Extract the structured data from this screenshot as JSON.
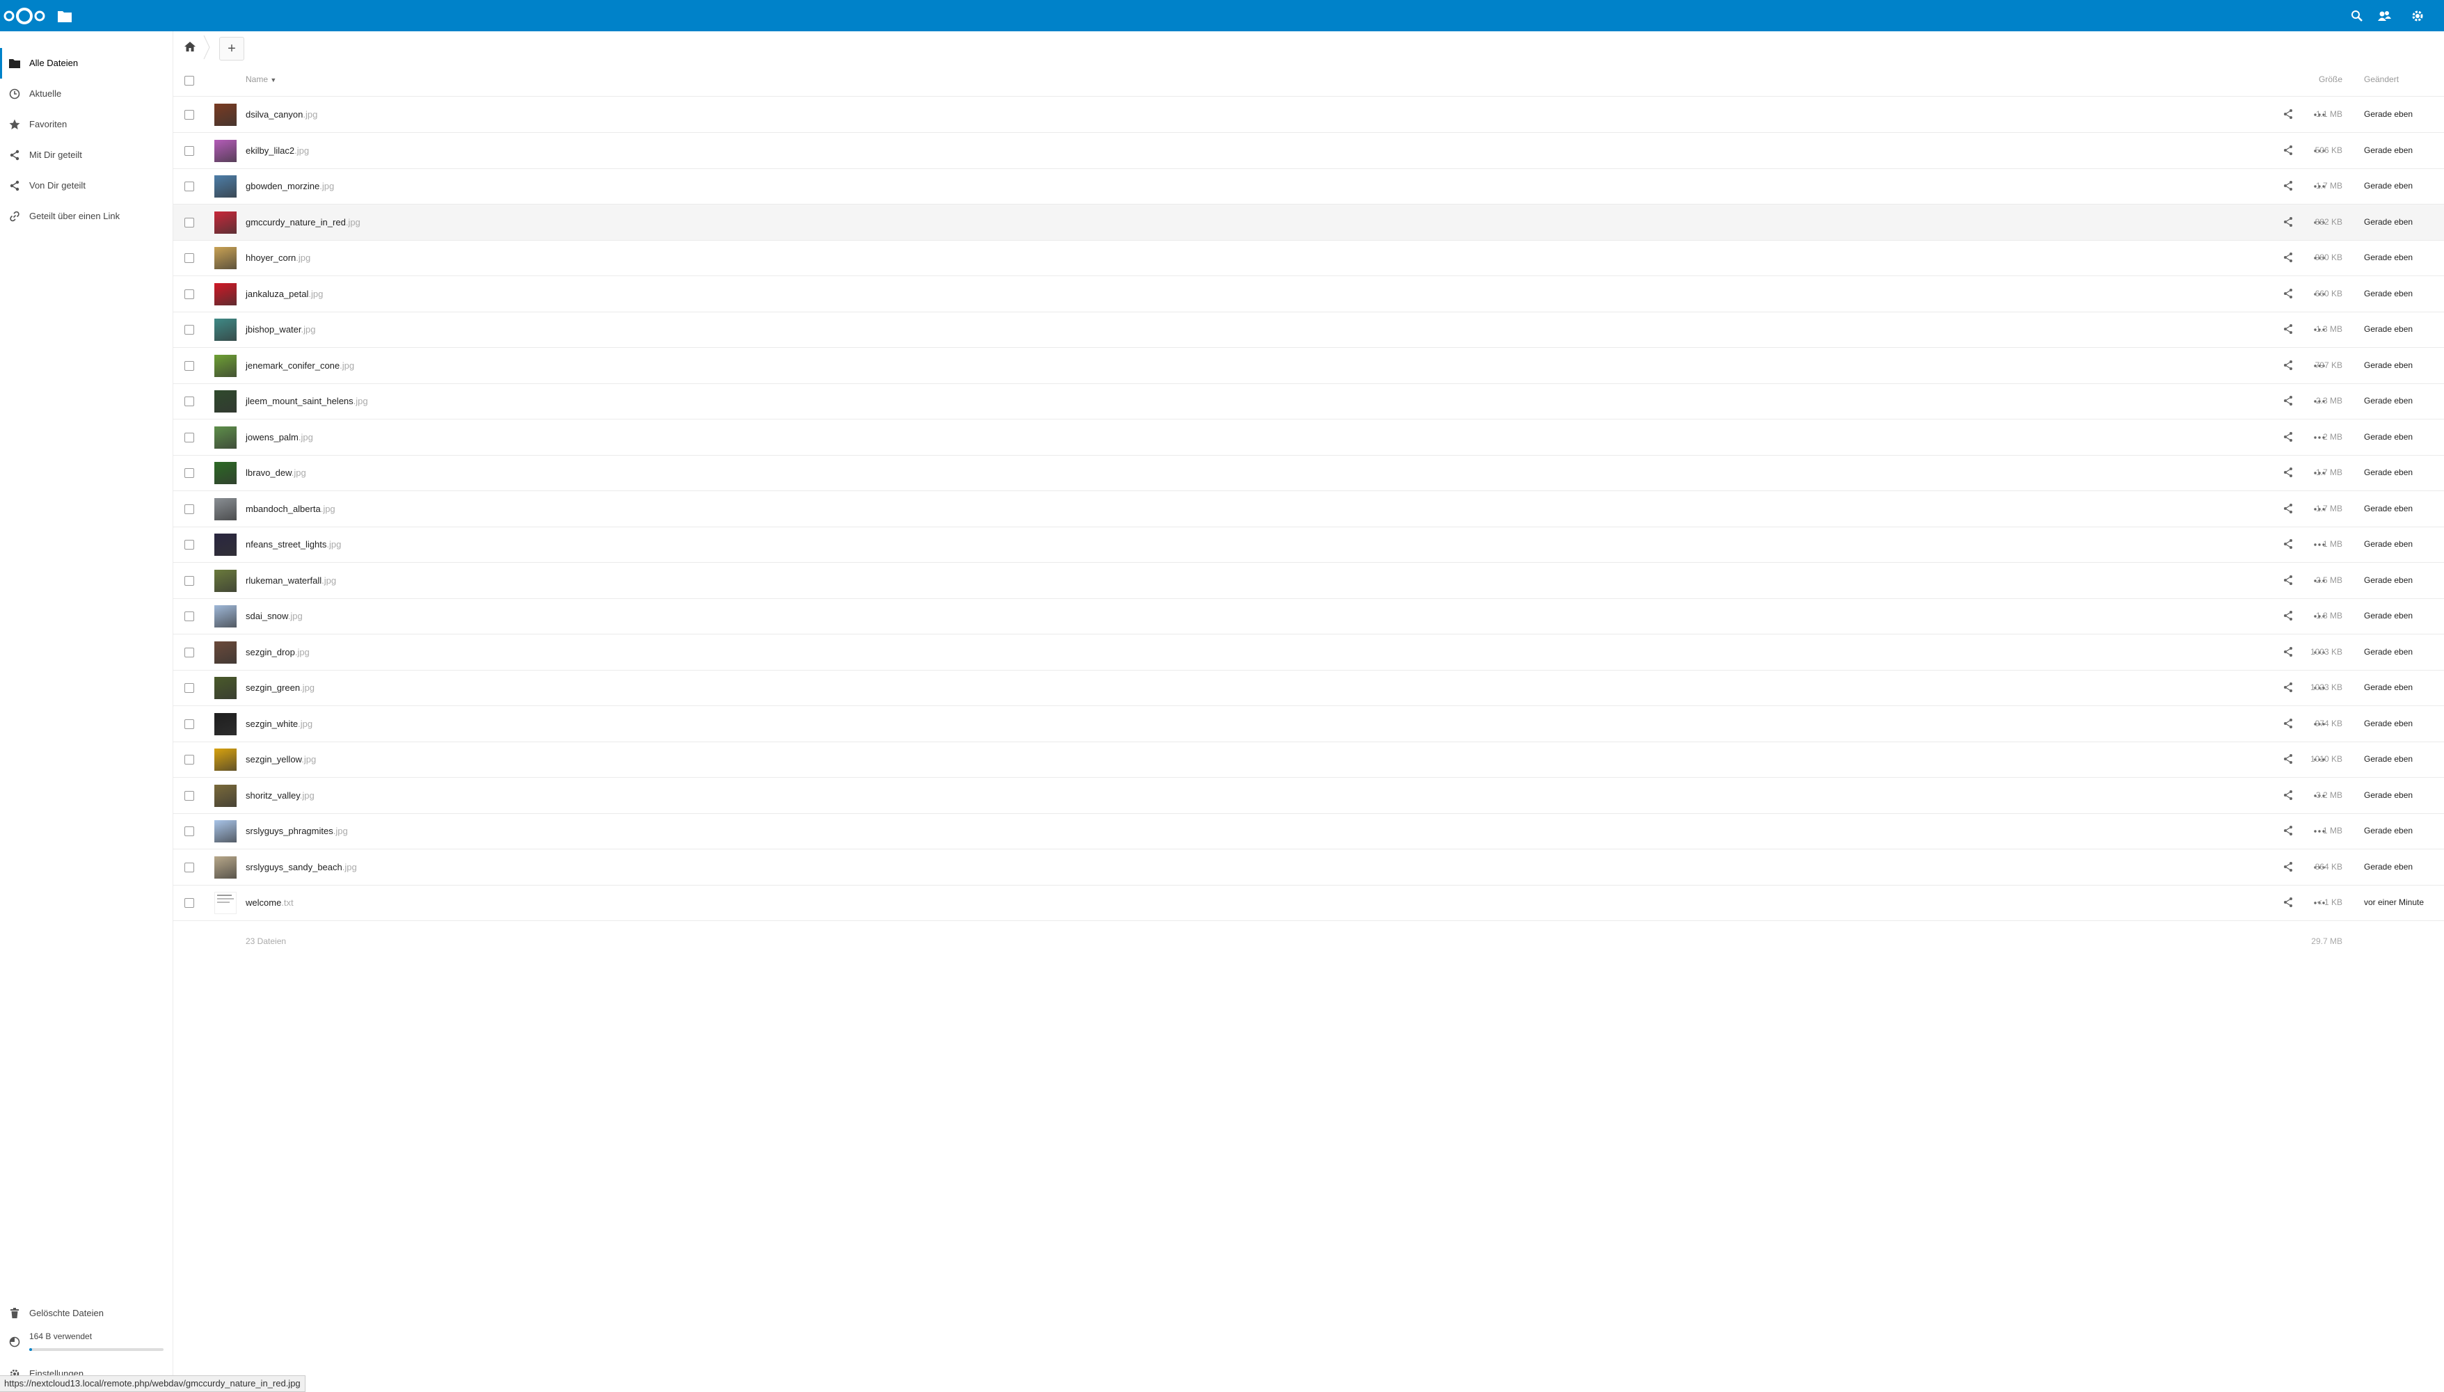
{
  "header": {
    "logo": "nextcloud-logo",
    "app_icon": "folder-icon",
    "right_icons": [
      "search-icon",
      "contacts-icon",
      "settings-gear-icon"
    ],
    "color": "#0082c9"
  },
  "sidebar": {
    "items": [
      {
        "label": "Alle Dateien",
        "icon": "folder-icon",
        "active": true
      },
      {
        "label": "Aktuelle",
        "icon": "clock-icon"
      },
      {
        "label": "Favoriten",
        "icon": "star-icon"
      },
      {
        "label": "Mit Dir geteilt",
        "icon": "share-icon"
      },
      {
        "label": "Von Dir geteilt",
        "icon": "share-icon"
      },
      {
        "label": "Geteilt über einen Link",
        "icon": "link-icon"
      }
    ],
    "trash_label": "Gelöschte Dateien",
    "quota_label": "164 B verwendet",
    "quota_fraction": 0.001,
    "settings_label": "Einstellungen"
  },
  "toolbar": {
    "new_label": "+"
  },
  "table": {
    "headers": {
      "name": "Name",
      "size": "Größe",
      "modified": "Geändert"
    },
    "rows": [
      {
        "name": "dsilva_canyon",
        "ext": ".jpg",
        "size": "1.1 MB",
        "modified": "Gerade eben",
        "thumb": "#7a3b22"
      },
      {
        "name": "ekilby_lilac2",
        "ext": ".jpg",
        "size": "506 KB",
        "modified": "Gerade eben",
        "thumb": "#b45cb8"
      },
      {
        "name": "gbowden_morzine",
        "ext": ".jpg",
        "size": "1.7 MB",
        "modified": "Gerade eben",
        "thumb": "#4d7ea8"
      },
      {
        "name": "gmccurdy_nature_in_red",
        "ext": ".jpg",
        "size": "882 KB",
        "modified": "Gerade eben",
        "thumb": "#c8283a"
      },
      {
        "name": "hhoyer_corn",
        "ext": ".jpg",
        "size": "980 KB",
        "modified": "Gerade eben",
        "thumb": "#c9a254"
      },
      {
        "name": "jankaluza_petal",
        "ext": ".jpg",
        "size": "660 KB",
        "modified": "Gerade eben",
        "thumb": "#d01826"
      },
      {
        "name": "jbishop_water",
        "ext": ".jpg",
        "size": "1.3 MB",
        "modified": "Gerade eben",
        "thumb": "#3f8a86"
      },
      {
        "name": "jenemark_conifer_cone",
        "ext": ".jpg",
        "size": "797 KB",
        "modified": "Gerade eben",
        "thumb": "#6ea034"
      },
      {
        "name": "jleem_mount_saint_helens",
        "ext": ".jpg",
        "size": "2.3 MB",
        "modified": "Gerade eben",
        "thumb": "#2f4a2c"
      },
      {
        "name": "jowens_palm",
        "ext": ".jpg",
        "size": "2 MB",
        "modified": "Gerade eben",
        "thumb": "#5e8f4a"
      },
      {
        "name": "lbravo_dew",
        "ext": ".jpg",
        "size": "1.7 MB",
        "modified": "Gerade eben",
        "thumb": "#2c6a24"
      },
      {
        "name": "mbandoch_alberta",
        "ext": ".jpg",
        "size": "1.7 MB",
        "modified": "Gerade eben",
        "thumb": "#8a8f94"
      },
      {
        "name": "nfeans_street_lights",
        "ext": ".jpg",
        "size": "1 MB",
        "modified": "Gerade eben",
        "thumb": "#2a2640"
      },
      {
        "name": "rlukeman_waterfall",
        "ext": ".jpg",
        "size": "2.5 MB",
        "modified": "Gerade eben",
        "thumb": "#6a7a3c"
      },
      {
        "name": "sdai_snow",
        "ext": ".jpg",
        "size": "1.8 MB",
        "modified": "Gerade eben",
        "thumb": "#9fb8d8"
      },
      {
        "name": "sezgin_drop",
        "ext": ".jpg",
        "size": "1003 KB",
        "modified": "Gerade eben",
        "thumb": "#6b4a3a"
      },
      {
        "name": "sezgin_green",
        "ext": ".jpg",
        "size": "1023 KB",
        "modified": "Gerade eben",
        "thumb": "#4a5a2a"
      },
      {
        "name": "sezgin_white",
        "ext": ".jpg",
        "size": "974 KB",
        "modified": "Gerade eben",
        "thumb": "#1e1e1e"
      },
      {
        "name": "sezgin_yellow",
        "ext": ".jpg",
        "size": "1010 KB",
        "modified": "Gerade eben",
        "thumb": "#d8a20e"
      },
      {
        "name": "shoritz_valley",
        "ext": ".jpg",
        "size": "3.2 MB",
        "modified": "Gerade eben",
        "thumb": "#7a6a3a"
      },
      {
        "name": "srslyguys_phragmites",
        "ext": ".jpg",
        "size": "1 MB",
        "modified": "Gerade eben",
        "thumb": "#a8c4e8"
      },
      {
        "name": "srslyguys_sandy_beach",
        "ext": ".jpg",
        "size": "864 KB",
        "modified": "Gerade eben",
        "thumb": "#b8a88a"
      },
      {
        "name": "welcome",
        "ext": ".txt",
        "size": "< 1 KB",
        "modified": "vor einer Minute",
        "thumb": "text"
      }
    ],
    "hover_row_index": 3,
    "summary_count": "23 Dateien",
    "summary_size": "29.7 MB"
  },
  "statusbar": {
    "url": "https://nextcloud13.local/remote.php/webdav/gmccurdy_nature_in_red.jpg"
  }
}
